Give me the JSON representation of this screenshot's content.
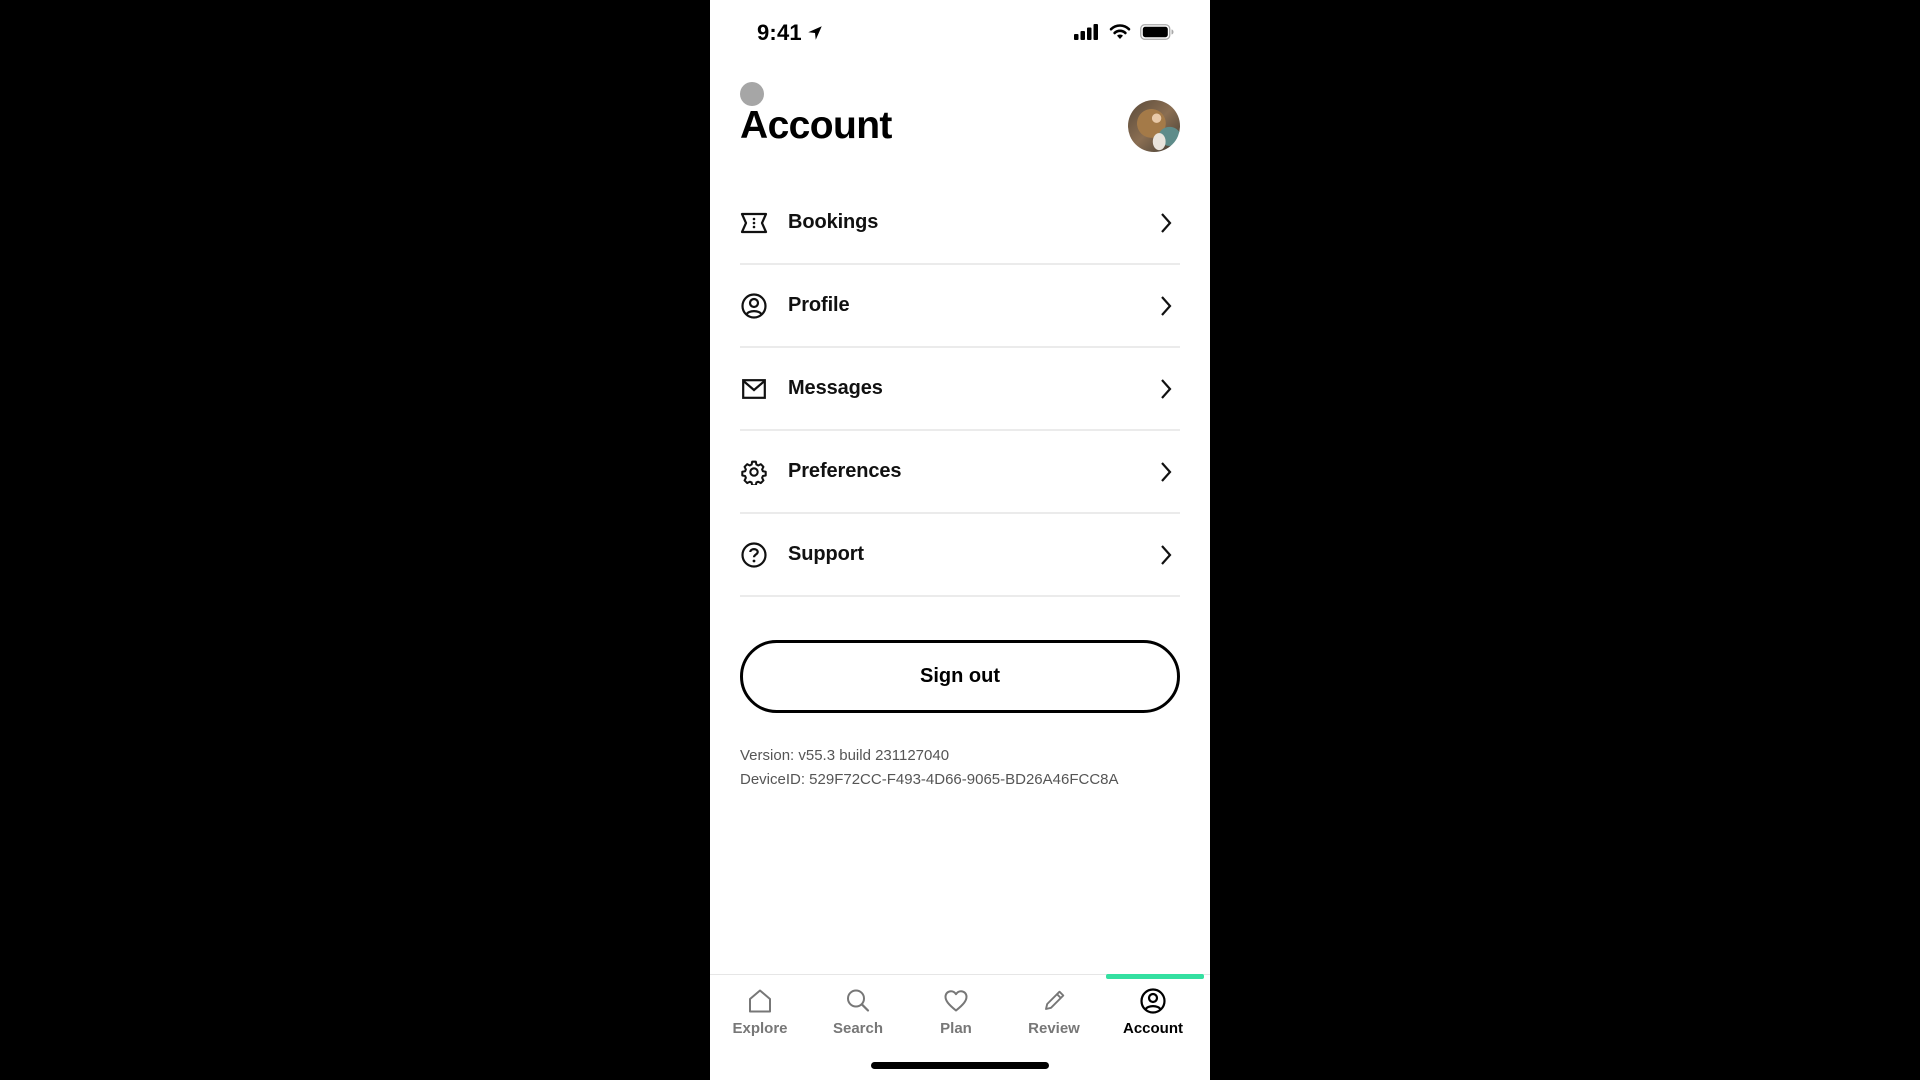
{
  "status_bar": {
    "time": "9:41",
    "icons": [
      "location-arrow-icon",
      "signal-icon",
      "wifi-icon",
      "battery-icon"
    ]
  },
  "header": {
    "title": "Account",
    "avatar_alt": "user-avatar"
  },
  "menu": {
    "items": [
      {
        "label": "Bookings",
        "icon": "ticket-icon"
      },
      {
        "label": "Profile",
        "icon": "user-circle-icon"
      },
      {
        "label": "Messages",
        "icon": "envelope-icon"
      },
      {
        "label": "Preferences",
        "icon": "gear-icon"
      },
      {
        "label": "Support",
        "icon": "question-circle-icon"
      }
    ]
  },
  "sign_out": {
    "label": "Sign out"
  },
  "meta": {
    "version": "Version: v55.3 build 231127040",
    "device_id": "DeviceID: 529F72CC-F493-4D66-9065-BD26A46FCC8A"
  },
  "tabbar": {
    "active": "Account",
    "accent_color": "#34e0a1",
    "tabs": [
      {
        "label": "Explore",
        "icon": "home-icon"
      },
      {
        "label": "Search",
        "icon": "search-icon"
      },
      {
        "label": "Plan",
        "icon": "heart-icon"
      },
      {
        "label": "Review",
        "icon": "pencil-icon"
      },
      {
        "label": "Account",
        "icon": "user-circle-icon"
      }
    ]
  }
}
